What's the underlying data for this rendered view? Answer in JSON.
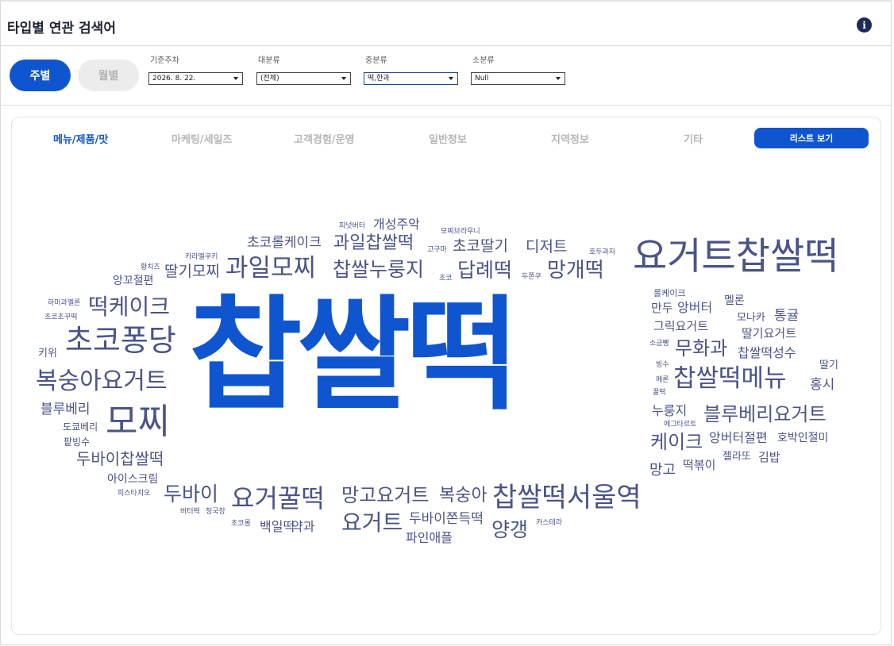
{
  "header": {
    "title": "타입별 연관 검색어"
  },
  "filters": {
    "period_buttons": [
      "주별",
      "월별"
    ],
    "fields": [
      {
        "label": "기준주차",
        "value": "2026. 8. 22."
      },
      {
        "label": "대분류",
        "value": "(전체)"
      },
      {
        "label": "중분류",
        "value": "떡,한과"
      },
      {
        "label": "소분류",
        "value": "Null"
      }
    ]
  },
  "tabs": [
    "메뉴/제품/맛",
    "마케팅/세일즈",
    "고객경험/운영",
    "일반정보",
    "지역정보",
    "기타"
  ],
  "list_button": "리스트 보기",
  "colors": {
    "primary": "#0f55d0",
    "word": "#4a5488"
  },
  "wordcloud": [
    {
      "text": "찹쌀떡",
      "primary": true
    },
    {
      "text": "요거트찹쌀떡"
    },
    {
      "text": "초코퐁당"
    },
    {
      "text": "모찌"
    },
    {
      "text": "복숭아요거트"
    },
    {
      "text": "과일모찌"
    },
    {
      "text": "찹쌀누룽지"
    },
    {
      "text": "과일찹쌀떡"
    },
    {
      "text": "답례떡"
    },
    {
      "text": "망개떡"
    },
    {
      "text": "떡케이크"
    },
    {
      "text": "딸기모찌"
    },
    {
      "text": "초코롤케이크"
    },
    {
      "text": "개성주악"
    },
    {
      "text": "초코딸기"
    },
    {
      "text": "디저트"
    },
    {
      "text": "앙꼬절편"
    },
    {
      "text": "요거꿀떡"
    },
    {
      "text": "찹쌀떡서울역"
    },
    {
      "text": "망고요거트"
    },
    {
      "text": "복숭아"
    },
    {
      "text": "요거트"
    },
    {
      "text": "양갱"
    },
    {
      "text": "두바이"
    },
    {
      "text": "두바이찹쌀떡"
    },
    {
      "text": "찹쌀떡메뉴"
    },
    {
      "text": "블루베리요거트"
    },
    {
      "text": "케이크"
    },
    {
      "text": "무화과"
    },
    {
      "text": "블루베리"
    },
    {
      "text": "두바이쫀득떡"
    },
    {
      "text": "파인애플"
    },
    {
      "text": "백일떡"
    },
    {
      "text": "약과"
    },
    {
      "text": "아이스크림"
    },
    {
      "text": "앙버터절편"
    },
    {
      "text": "호박인절미"
    },
    {
      "text": "찹쌀떡성수"
    },
    {
      "text": "딸기요거트"
    },
    {
      "text": "그릭요거트"
    },
    {
      "text": "통귤"
    },
    {
      "text": "홍시"
    },
    {
      "text": "누룽지"
    },
    {
      "text": "망고"
    },
    {
      "text": "떡볶이"
    },
    {
      "text": "김밥"
    },
    {
      "text": "젤라또"
    },
    {
      "text": "앙버터"
    },
    {
      "text": "멜론"
    },
    {
      "text": "만두"
    },
    {
      "text": "딸기"
    },
    {
      "text": "모나카"
    },
    {
      "text": "키위"
    },
    {
      "text": "도쿄베리"
    },
    {
      "text": "팥빙수"
    },
    {
      "text": "피넛버터"
    },
    {
      "text": "모찌브라우니"
    },
    {
      "text": "고구마"
    },
    {
      "text": "호두과자"
    },
    {
      "text": "카라멜쿠키"
    },
    {
      "text": "황치즈"
    },
    {
      "text": "초코"
    },
    {
      "text": "두쫀쿠"
    },
    {
      "text": "하미과멜론"
    },
    {
      "text": "초코초꾸떡"
    },
    {
      "text": "롤케이크"
    },
    {
      "text": "소금빵"
    },
    {
      "text": "빙수"
    },
    {
      "text": "메론"
    },
    {
      "text": "꿀떡"
    },
    {
      "text": "에그타르트"
    },
    {
      "text": "피스타치오"
    },
    {
      "text": "버터떡"
    },
    {
      "text": "청국장"
    },
    {
      "text": "초코롤"
    },
    {
      "text": "카스테라"
    }
  ]
}
